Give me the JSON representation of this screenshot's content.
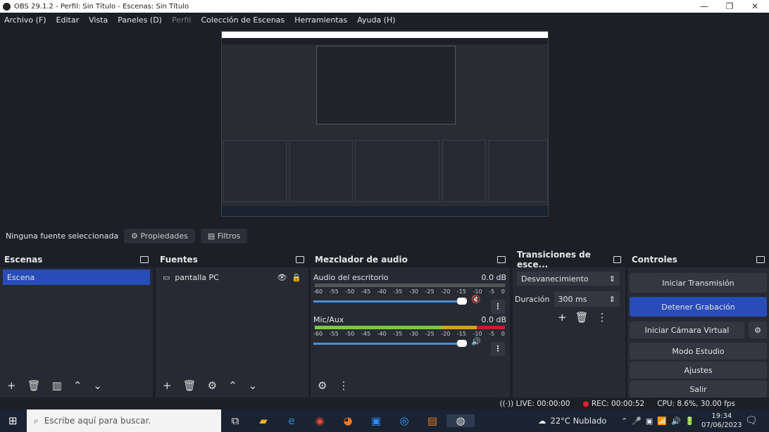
{
  "window": {
    "title": "OBS 29.1.2 - Perfil: Sin Título - Escenas: Sin Título",
    "minimize": "—",
    "maximize": "❐",
    "close": "✕"
  },
  "menu": [
    "Archivo (F)",
    "Editar",
    "Vista",
    "Paneles (D)",
    "Perfil",
    "Colección de Escenas",
    "Herramientas",
    "Ayuda (H)"
  ],
  "context": {
    "no_source": "Ninguna fuente seleccionada",
    "properties": "Propiedades",
    "filters": "Filtros"
  },
  "scenes": {
    "title": "Escenas",
    "items": [
      "Escena"
    ]
  },
  "sources": {
    "title": "Fuentes",
    "items": [
      "pantalla PC"
    ]
  },
  "mixer": {
    "title": "Mezclador de audio",
    "channels": [
      {
        "name": "Audio del escritorio",
        "db": "0.0 dB",
        "muted": true,
        "level": 0
      },
      {
        "name": "Mic/Aux",
        "db": "0.0 dB",
        "muted": false,
        "level": 1.0
      }
    ],
    "ticks": [
      "-60",
      "-55",
      "-50",
      "-45",
      "-40",
      "-35",
      "-30",
      "-25",
      "-20",
      "-15",
      "-10",
      "-5",
      "0"
    ]
  },
  "transitions": {
    "title": "Transiciones de esce...",
    "selected": "Desvanecimiento",
    "duration_label": "Duración",
    "duration": "300 ms"
  },
  "controls": {
    "title": "Controles",
    "buttons": [
      "Iniciar Transmisión",
      "Detener Grabación",
      "Iniciar Cámara Virtual",
      "Modo Estudio",
      "Ajustes",
      "Salir"
    ]
  },
  "status": {
    "live": "LIVE: 00:00:00",
    "rec": "REC: 00:00:52",
    "cpu": "CPU: 8.6%, 30.00 fps"
  },
  "taskbar": {
    "search_placeholder": "Escribe aquí para buscar.",
    "weather": "22°C  Nublado",
    "time": "19:34",
    "date": "07/06/2023"
  },
  "colors": {
    "accent": "#284cb8",
    "rec": "#e0202e",
    "meter_green": "#7ac943",
    "meter_yellow": "#d6a21e",
    "meter_red": "#c0202e"
  }
}
